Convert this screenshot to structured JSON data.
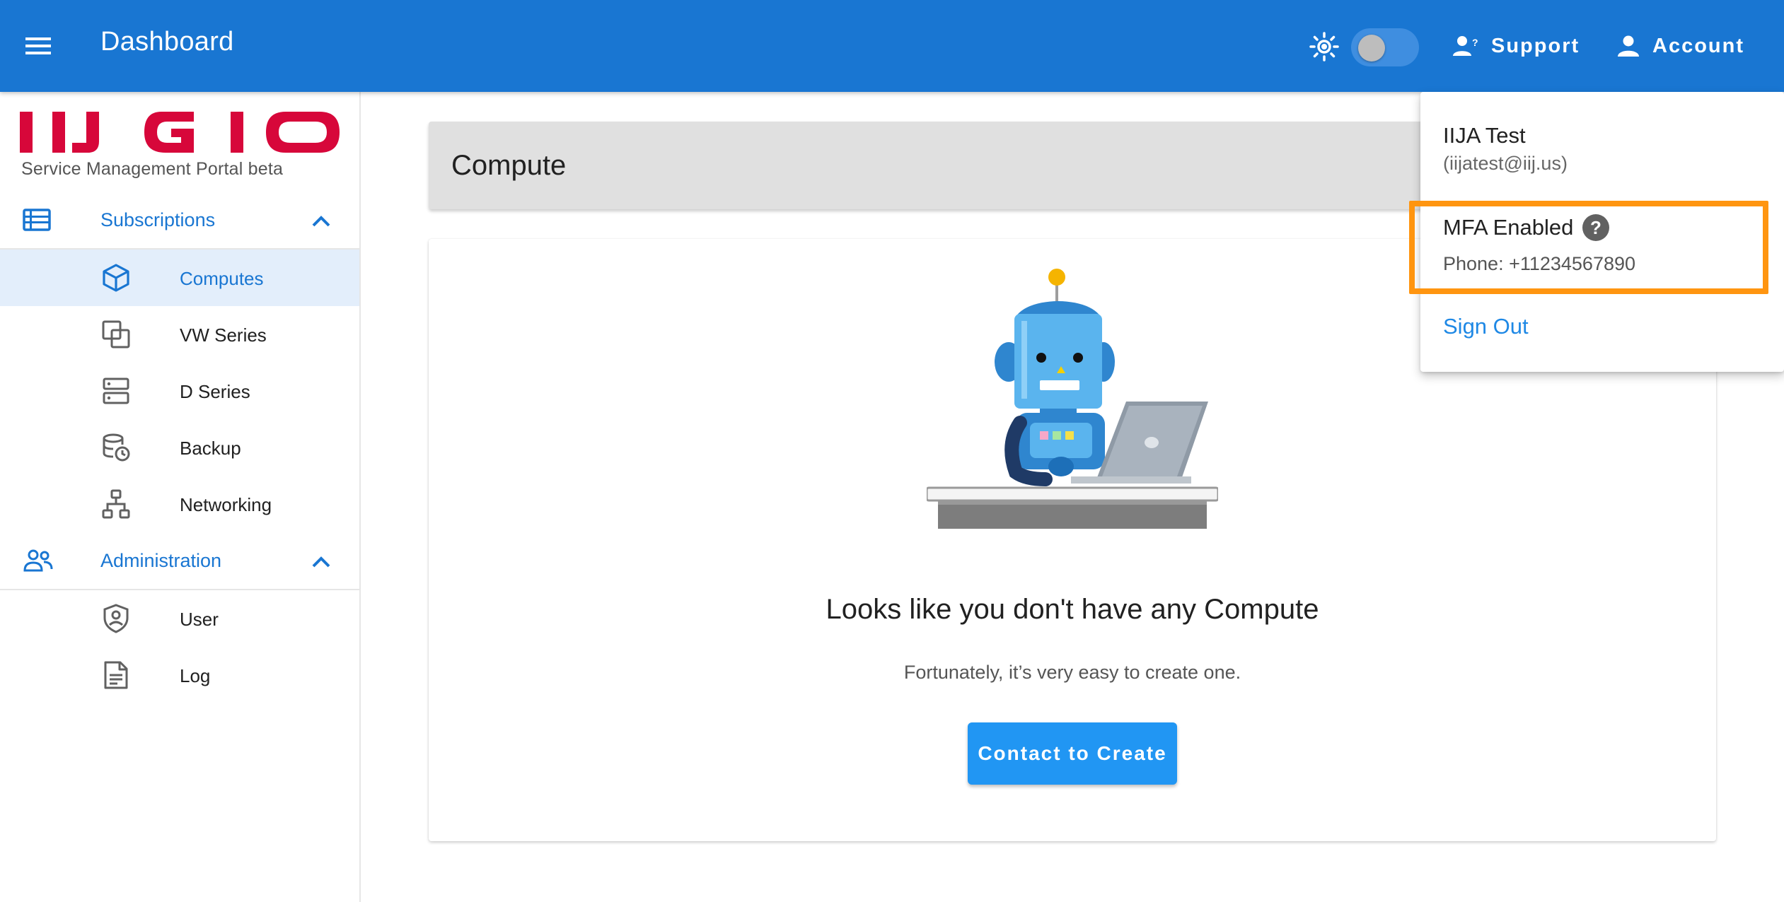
{
  "appbar": {
    "title": "Dashboard",
    "support_label": "Support",
    "account_label": "Account",
    "theme_toggle_on": false,
    "bar_color": "#1976d2"
  },
  "sidebar": {
    "logo_text": "IIJ GIO",
    "portal_subtitle": "Service Management Portal beta",
    "sections": [
      {
        "label": "Subscriptions",
        "icon": "list-icon",
        "expanded": true,
        "items": [
          {
            "label": "Computes",
            "icon": "cube-icon",
            "active": true
          },
          {
            "label": "VW Series",
            "icon": "copy-squares-icon",
            "active": false
          },
          {
            "label": "D Series",
            "icon": "server-icon",
            "active": false
          },
          {
            "label": "Backup",
            "icon": "database-clock-icon",
            "active": false
          },
          {
            "label": "Networking",
            "icon": "network-icon",
            "active": false
          }
        ]
      },
      {
        "label": "Administration",
        "icon": "people-icon",
        "expanded": true,
        "items": [
          {
            "label": "User",
            "icon": "shield-user-icon",
            "active": false
          },
          {
            "label": "Log",
            "icon": "document-icon",
            "active": false
          }
        ]
      }
    ]
  },
  "main": {
    "page_title": "Compute",
    "empty_title": "Looks like you don't have any Compute",
    "empty_subtitle": "Fortunately, it’s very easy to create one.",
    "cta_label": "Contact to Create"
  },
  "account_menu": {
    "user_name": "IIJA Test",
    "user_email": "(iijatest@iij.us)",
    "mfa_label": "MFA Enabled",
    "phone": "Phone: +11234567890",
    "sign_out": "Sign Out",
    "highlight_color": "#ff9510"
  }
}
